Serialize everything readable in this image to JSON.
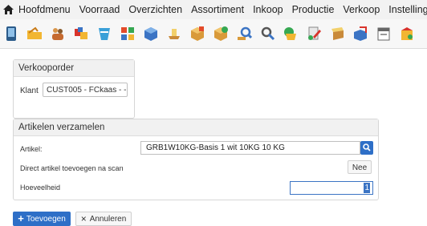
{
  "menu": {
    "items": [
      "Hoofdmenu",
      "Voorraad",
      "Overzichten",
      "Assortiment",
      "Inkoop",
      "Productie",
      "Verkoop",
      "Instellinge"
    ]
  },
  "toolbar": {
    "icons": [
      "phone-icon",
      "folder-icon",
      "team-icon",
      "dice-icon",
      "clipboard-icon",
      "box-icon",
      "cube-icon",
      "truck-icon",
      "package-icon",
      "package-add-icon",
      "search-icon",
      "search-user-icon",
      "globe-doc-icon",
      "edit-doc-icon",
      "book-icon",
      "box-transfer-icon",
      "calendar-icon",
      "chart-icon"
    ]
  },
  "verkooporder": {
    "title": "Verkooporder",
    "klant_label": "Klant",
    "klant_value": "CUST005 - FCkaas - -"
  },
  "artikelen": {
    "title": "Artikelen verzamelen",
    "artikel_label": "Artikel:",
    "artikel_value": "GRB1W10KG-Basis 1 wit 10KG 10 KG",
    "direct_label": "Direct artikel toevoegen na scan",
    "direct_value": "Nee",
    "hoeveelheid_label": "Hoeveelheid",
    "hoeveelheid_value": "1"
  },
  "actions": {
    "add_label": "Toevoegen",
    "cancel_label": "Annuleren"
  },
  "colors": {
    "accent": "#2e6fc7",
    "menubar_bg": "#f2f2f2"
  }
}
